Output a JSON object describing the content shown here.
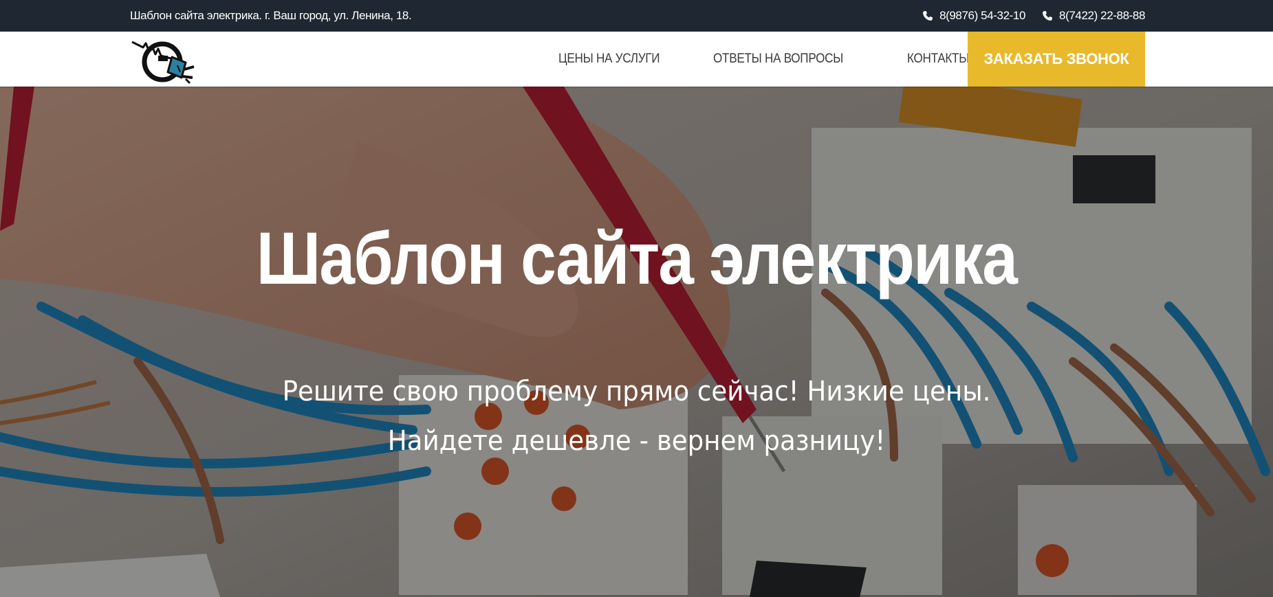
{
  "topbar": {
    "address": "Шаблон сайта электрика. г. Ваш город, ул. Ленина, 18.",
    "phones": [
      {
        "number": "8(9876) 54-32-10",
        "icon": "phone-icon"
      },
      {
        "number": "8(7422) 22-88-88",
        "icon": "phone-icon"
      }
    ]
  },
  "nav": {
    "logo": "electric-plug-logo",
    "links": [
      {
        "label": "ЦЕНЫ НА УСЛУГИ"
      },
      {
        "label": "ОТВЕТЫ НА ВОПРОСЫ"
      },
      {
        "label": "КОНТАКТЫ"
      }
    ],
    "cta_label": "ЗАКАЗАТЬ ЗВОНОК"
  },
  "hero": {
    "title": "Шаблон сайта электрика",
    "subtitle_line1": "Решите свою проблему прямо сейчас! Низкие цены.",
    "subtitle_line2": "Найдете дешевле - вернем разницу!"
  },
  "colors": {
    "topbar_bg": "#1f2832",
    "accent": "#e8b92b",
    "nav_text": "#3b3b3b"
  }
}
